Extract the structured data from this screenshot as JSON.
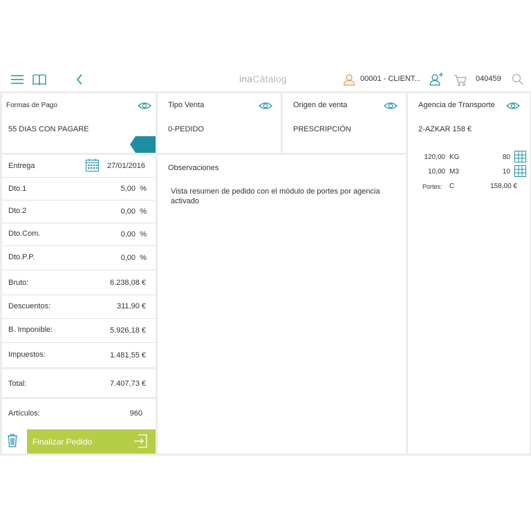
{
  "header": {
    "app_title_prefix": "ina",
    "app_title_suffix": "Cátalog",
    "client_label": "00001 - CLIENT...",
    "cart_count": "040459"
  },
  "payment": {
    "title": "Formas de Pago",
    "value": "55 DIAS CON PAGARE"
  },
  "sale_type": {
    "title": "Tipo Venta",
    "value": "0-PEDIDO"
  },
  "sale_origin": {
    "title": "Origen de venta",
    "value": "PRESCRIPCIÓN"
  },
  "transport": {
    "title": "Agencia de Transporte",
    "value": "2-AZKAR 158 €",
    "rows": [
      {
        "amount": "120,00",
        "unit": "KG",
        "qty": "80"
      },
      {
        "amount": "10,00",
        "unit": "M3",
        "qty": "10"
      }
    ],
    "portes_label": "Portes:",
    "portes_code": "C",
    "portes_value": "158,00 €"
  },
  "delivery": {
    "label": "Entrega",
    "date": "27/01/2016"
  },
  "discounts": [
    {
      "label": "Dto.1",
      "value": "5,00",
      "unit": "%"
    },
    {
      "label": "Dto.2",
      "value": "0,00",
      "unit": "%"
    },
    {
      "label": "Dto.Com.",
      "value": "0,00",
      "unit": "%"
    },
    {
      "label": "Dto.P.P.",
      "value": "0,00",
      "unit": "%"
    }
  ],
  "totals": [
    {
      "label": "Bruto:",
      "value": "6.238,08 €"
    },
    {
      "label": "Descuentos:",
      "value": "311,90 €"
    },
    {
      "label": "B. Imponible:",
      "value": "5.926,18 €"
    },
    {
      "label": "Impuestos:",
      "value": "1.481,55 €"
    },
    {
      "label": "Total:",
      "value": "7.407,73 €"
    },
    {
      "label": "Artículos:",
      "value": "960"
    }
  ],
  "observations": {
    "title": "Observaciones",
    "text": "Vista resumen de pedido con el módulo de portes por agencia activado"
  },
  "actions": {
    "finalize_label": "Finalizar Pedido"
  },
  "colors": {
    "accent_teal": "#1f8fa0",
    "finalize_green": "#b6cd46",
    "client_icon_orange": "#e6905a",
    "tab_teal": "#1e8fa0"
  }
}
